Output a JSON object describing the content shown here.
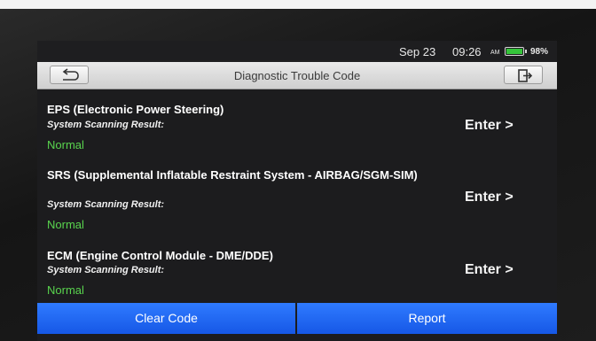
{
  "status_bar": {
    "date": "Sep 23",
    "time": "09:26",
    "ampm": "AM",
    "battery_percent": "98%",
    "battery_color": "#35c43a"
  },
  "header": {
    "title": "Diagnostic Trouble Code",
    "back_icon": "back-arrow-icon",
    "exit_icon": "exit-door-icon"
  },
  "systems": [
    {
      "name": "EPS (Electronic Power Steering)",
      "result_label": "System Scanning Result:",
      "result": "Normal",
      "action": "Enter >"
    },
    {
      "name": "SRS (Supplemental Inflatable Restraint System - AIRBAG/SGM-SIM)",
      "result_label": "System Scanning Result:",
      "result": "Normal",
      "action": "Enter >"
    },
    {
      "name": "ECM (Engine Control Module - DME/DDE)",
      "result_label": "System Scanning Result:",
      "result": "Normal",
      "action": "Enter >"
    }
  ],
  "footer": {
    "clear_label": "Clear Code",
    "report_label": "Report",
    "accent": "#1f6cf5"
  },
  "colors": {
    "normal_status": "#59d44e"
  }
}
